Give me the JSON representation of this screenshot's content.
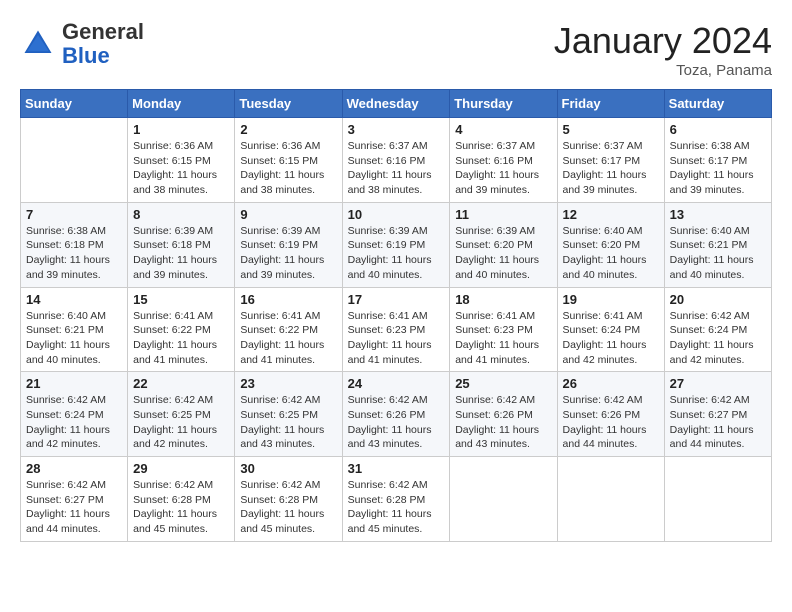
{
  "header": {
    "logo_general": "General",
    "logo_blue": "Blue",
    "month_title": "January 2024",
    "location": "Toza, Panama"
  },
  "days_of_week": [
    "Sunday",
    "Monday",
    "Tuesday",
    "Wednesday",
    "Thursday",
    "Friday",
    "Saturday"
  ],
  "weeks": [
    [
      {
        "day": "",
        "info": ""
      },
      {
        "day": "1",
        "info": "Sunrise: 6:36 AM\nSunset: 6:15 PM\nDaylight: 11 hours and 38 minutes."
      },
      {
        "day": "2",
        "info": "Sunrise: 6:36 AM\nSunset: 6:15 PM\nDaylight: 11 hours and 38 minutes."
      },
      {
        "day": "3",
        "info": "Sunrise: 6:37 AM\nSunset: 6:16 PM\nDaylight: 11 hours and 38 minutes."
      },
      {
        "day": "4",
        "info": "Sunrise: 6:37 AM\nSunset: 6:16 PM\nDaylight: 11 hours and 39 minutes."
      },
      {
        "day": "5",
        "info": "Sunrise: 6:37 AM\nSunset: 6:17 PM\nDaylight: 11 hours and 39 minutes."
      },
      {
        "day": "6",
        "info": "Sunrise: 6:38 AM\nSunset: 6:17 PM\nDaylight: 11 hours and 39 minutes."
      }
    ],
    [
      {
        "day": "7",
        "info": "Sunrise: 6:38 AM\nSunset: 6:18 PM\nDaylight: 11 hours and 39 minutes."
      },
      {
        "day": "8",
        "info": "Sunrise: 6:39 AM\nSunset: 6:18 PM\nDaylight: 11 hours and 39 minutes."
      },
      {
        "day": "9",
        "info": "Sunrise: 6:39 AM\nSunset: 6:19 PM\nDaylight: 11 hours and 39 minutes."
      },
      {
        "day": "10",
        "info": "Sunrise: 6:39 AM\nSunset: 6:19 PM\nDaylight: 11 hours and 40 minutes."
      },
      {
        "day": "11",
        "info": "Sunrise: 6:39 AM\nSunset: 6:20 PM\nDaylight: 11 hours and 40 minutes."
      },
      {
        "day": "12",
        "info": "Sunrise: 6:40 AM\nSunset: 6:20 PM\nDaylight: 11 hours and 40 minutes."
      },
      {
        "day": "13",
        "info": "Sunrise: 6:40 AM\nSunset: 6:21 PM\nDaylight: 11 hours and 40 minutes."
      }
    ],
    [
      {
        "day": "14",
        "info": "Sunrise: 6:40 AM\nSunset: 6:21 PM\nDaylight: 11 hours and 40 minutes."
      },
      {
        "day": "15",
        "info": "Sunrise: 6:41 AM\nSunset: 6:22 PM\nDaylight: 11 hours and 41 minutes."
      },
      {
        "day": "16",
        "info": "Sunrise: 6:41 AM\nSunset: 6:22 PM\nDaylight: 11 hours and 41 minutes."
      },
      {
        "day": "17",
        "info": "Sunrise: 6:41 AM\nSunset: 6:23 PM\nDaylight: 11 hours and 41 minutes."
      },
      {
        "day": "18",
        "info": "Sunrise: 6:41 AM\nSunset: 6:23 PM\nDaylight: 11 hours and 41 minutes."
      },
      {
        "day": "19",
        "info": "Sunrise: 6:41 AM\nSunset: 6:24 PM\nDaylight: 11 hours and 42 minutes."
      },
      {
        "day": "20",
        "info": "Sunrise: 6:42 AM\nSunset: 6:24 PM\nDaylight: 11 hours and 42 minutes."
      }
    ],
    [
      {
        "day": "21",
        "info": "Sunrise: 6:42 AM\nSunset: 6:24 PM\nDaylight: 11 hours and 42 minutes."
      },
      {
        "day": "22",
        "info": "Sunrise: 6:42 AM\nSunset: 6:25 PM\nDaylight: 11 hours and 42 minutes."
      },
      {
        "day": "23",
        "info": "Sunrise: 6:42 AM\nSunset: 6:25 PM\nDaylight: 11 hours and 43 minutes."
      },
      {
        "day": "24",
        "info": "Sunrise: 6:42 AM\nSunset: 6:26 PM\nDaylight: 11 hours and 43 minutes."
      },
      {
        "day": "25",
        "info": "Sunrise: 6:42 AM\nSunset: 6:26 PM\nDaylight: 11 hours and 43 minutes."
      },
      {
        "day": "26",
        "info": "Sunrise: 6:42 AM\nSunset: 6:26 PM\nDaylight: 11 hours and 44 minutes."
      },
      {
        "day": "27",
        "info": "Sunrise: 6:42 AM\nSunset: 6:27 PM\nDaylight: 11 hours and 44 minutes."
      }
    ],
    [
      {
        "day": "28",
        "info": "Sunrise: 6:42 AM\nSunset: 6:27 PM\nDaylight: 11 hours and 44 minutes."
      },
      {
        "day": "29",
        "info": "Sunrise: 6:42 AM\nSunset: 6:28 PM\nDaylight: 11 hours and 45 minutes."
      },
      {
        "day": "30",
        "info": "Sunrise: 6:42 AM\nSunset: 6:28 PM\nDaylight: 11 hours and 45 minutes."
      },
      {
        "day": "31",
        "info": "Sunrise: 6:42 AM\nSunset: 6:28 PM\nDaylight: 11 hours and 45 minutes."
      },
      {
        "day": "",
        "info": ""
      },
      {
        "day": "",
        "info": ""
      },
      {
        "day": "",
        "info": ""
      }
    ]
  ]
}
